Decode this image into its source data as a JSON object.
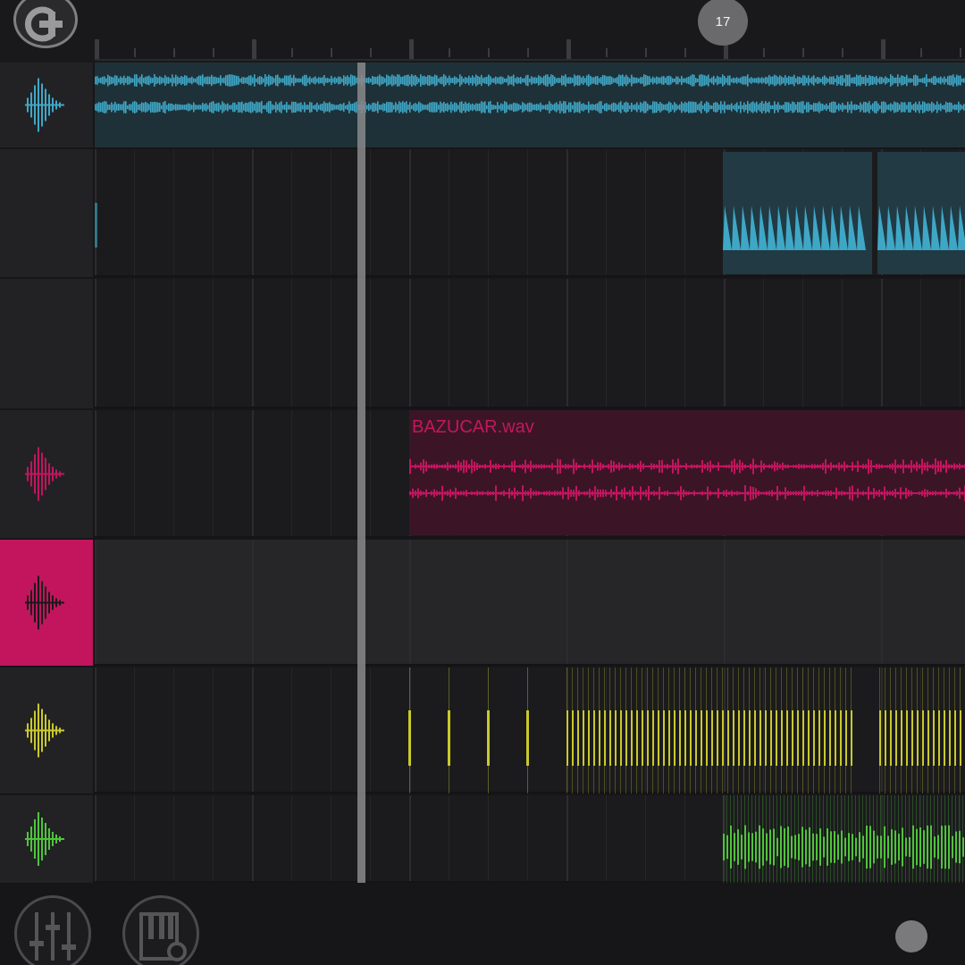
{
  "app": {
    "name": "audio-sequencer-arrangement"
  },
  "colors": {
    "background": "#161618",
    "track_blue": "#3fa7c6",
    "track_pink": "#c2155e",
    "track_yellow": "#c9c92a",
    "track_green": "#4fc43a",
    "selected_track": "#c2155e",
    "playhead": "#8a8a8c"
  },
  "timeline": {
    "position_marker": "17"
  },
  "tracks": [
    {
      "id": "track-1",
      "color": "#3fa7c6",
      "icon": "waveform-icon",
      "selected": false
    },
    {
      "id": "track-2",
      "color": "#3fa7c6",
      "icon": "none",
      "selected": false
    },
    {
      "id": "track-3",
      "color": "#3fa7c6",
      "icon": "none",
      "selected": false
    },
    {
      "id": "track-4",
      "color": "#c2155e",
      "icon": "waveform-icon",
      "selected": false,
      "clip_name": "BAZUCAR.wav"
    },
    {
      "id": "track-5",
      "color": "#1a1a1a",
      "icon": "waveform-icon",
      "selected": true
    },
    {
      "id": "track-6",
      "color": "#c9c92a",
      "icon": "waveform-icon",
      "selected": false
    },
    {
      "id": "track-7",
      "color": "#4fc43a",
      "icon": "waveform-icon",
      "selected": false
    }
  ],
  "bottom_bar": {
    "mixer_icon": "mixer-sliders-icon",
    "instrument_settings_icon": "piano-settings-icon"
  }
}
